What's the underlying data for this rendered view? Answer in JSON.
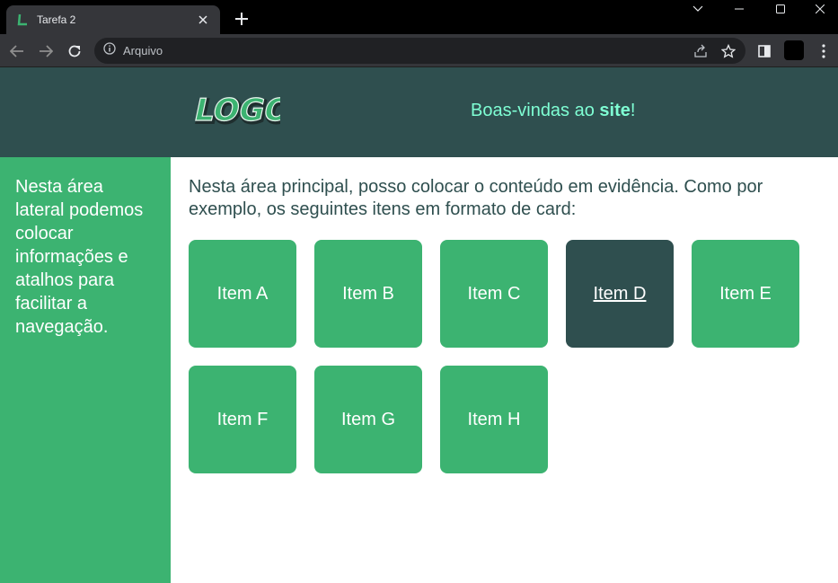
{
  "browser": {
    "tab_title": "Tarefa 2",
    "address": "Arquivo",
    "colors": {
      "titlebar": "#000000",
      "toolbar": "#35363a",
      "omnibox": "#202124"
    },
    "icons": [
      "tab-favicon",
      "close-icon",
      "plus-icon",
      "minimize-icon",
      "maximize-icon",
      "close-window-icon",
      "back-arrow-icon",
      "forward-arrow-icon",
      "reload-icon",
      "info-icon",
      "share-icon",
      "star-icon",
      "sidepanel-icon",
      "kebab-menu-icon"
    ]
  },
  "header": {
    "logo_text": "LOGO",
    "welcome_prefix": "Boas-vindas ao ",
    "welcome_bold": "site",
    "welcome_suffix": "!",
    "colors": {
      "background": "#2f4f4f",
      "text": "#7fffd4"
    }
  },
  "sidebar": {
    "text": "Nesta área lateral podemos colocar informações e atalhos para facilitar a navegação.",
    "color": "#3cb371"
  },
  "main": {
    "intro": "Nesta área principal, posso colocar o conteúdo em evidência. Como por exemplo, os seguintes itens em formato de card:",
    "cards": [
      {
        "label": "Item A",
        "hovered": false
      },
      {
        "label": "Item B",
        "hovered": false
      },
      {
        "label": "Item C",
        "hovered": false
      },
      {
        "label": "Item D",
        "hovered": true
      },
      {
        "label": "Item E",
        "hovered": false
      },
      {
        "label": "Item F",
        "hovered": false
      },
      {
        "label": "Item G",
        "hovered": false
      },
      {
        "label": "Item H",
        "hovered": false
      }
    ],
    "colors": {
      "card": "#3cb371",
      "card_hover": "#2f4f4f",
      "intro_text": "#2f4f4f"
    }
  }
}
